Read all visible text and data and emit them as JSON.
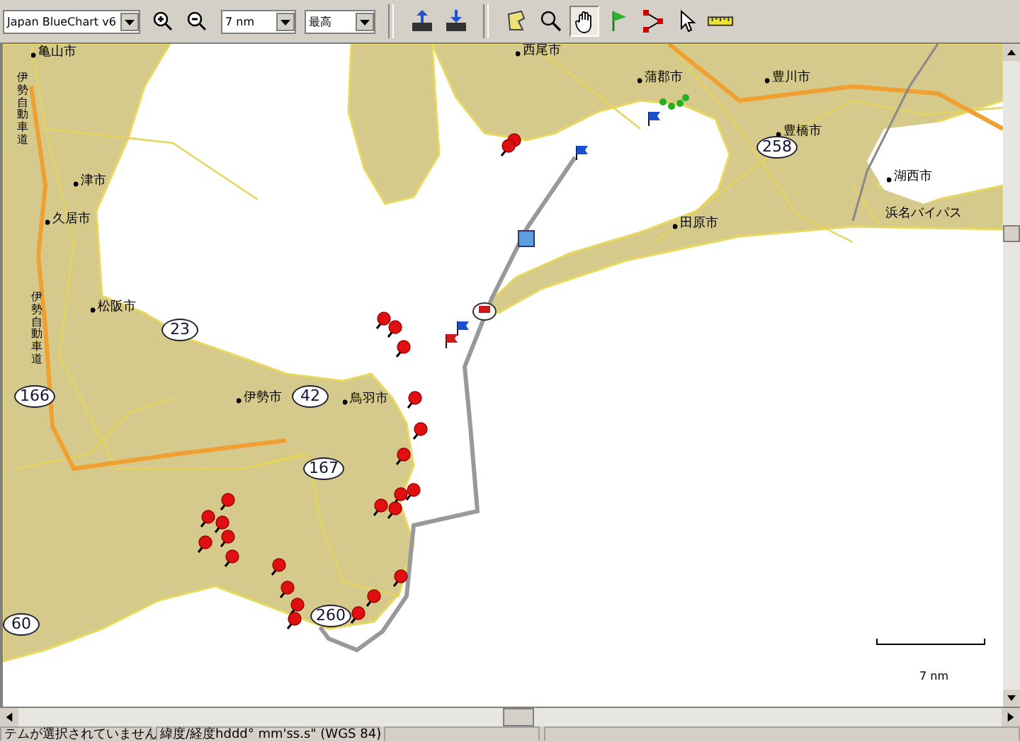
{
  "toolbar": {
    "map_product": {
      "value": "Japan BlueChart v6"
    },
    "zoom_scale": {
      "value": "7 nm"
    },
    "detail_level": {
      "value": "最高"
    },
    "tools": [
      {
        "selected": false
      },
      {
        "selected": false
      },
      {
        "selected": false
      },
      {
        "selected": false
      },
      {
        "selected": true
      },
      {
        "selected": false
      },
      {
        "selected": false
      },
      {
        "selected": false
      },
      {
        "selected": false
      }
    ]
  },
  "map": {
    "labels": [
      {
        "text": "亀山市",
        "kind": "city"
      },
      {
        "text": "伊勢自動車道",
        "kind": "vertical"
      },
      {
        "text": "津市",
        "kind": "city"
      },
      {
        "text": "久居市",
        "kind": "city"
      },
      {
        "text": "伊勢自動車道",
        "kind": "vertical"
      },
      {
        "text": "松阪市",
        "kind": "city"
      },
      {
        "text": "伊勢市",
        "kind": "city"
      },
      {
        "text": "鳥羽市",
        "kind": "city"
      },
      {
        "text": "西尾市",
        "kind": "city"
      },
      {
        "text": "蒲郡市",
        "kind": "city"
      },
      {
        "text": "豊川市",
        "kind": "city"
      },
      {
        "text": "豊橋市",
        "kind": "city"
      },
      {
        "text": "田原市",
        "kind": "city"
      },
      {
        "text": "湖西市",
        "kind": "city"
      },
      {
        "text": "浜名バイパス",
        "kind": "road"
      }
    ],
    "road_shields": [
      {
        "number": "23"
      },
      {
        "number": "166"
      },
      {
        "number": "42"
      },
      {
        "number": "167"
      },
      {
        "number": "258"
      },
      {
        "number": "60"
      },
      {
        "number": "260"
      }
    ],
    "scale": {
      "label": "7 nm"
    }
  },
  "status_bar": [
    "テムが選択されていません",
    "緯度/経度hddd° mm'ss.s\" (WGS 84)"
  ]
}
